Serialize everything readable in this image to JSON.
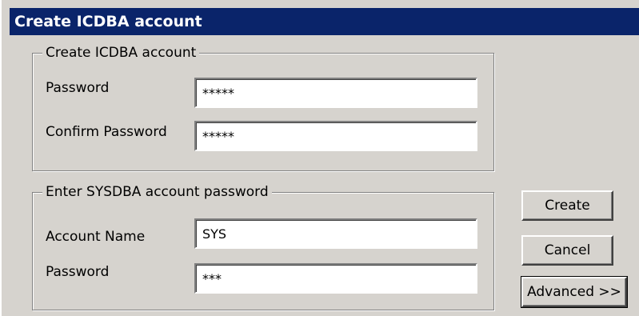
{
  "window": {
    "title": "Create ICDBA account"
  },
  "icdba_group": {
    "label": "Create ICDBA account",
    "password_label": "Password",
    "password_value": "*****",
    "confirm_label": "Confirm Password",
    "confirm_value": "*****"
  },
  "sysdba_group": {
    "label": "Enter SYSDBA account password",
    "account_label": "Account Name",
    "account_value": "SYS",
    "password_label": "Password",
    "password_value": "***"
  },
  "buttons": {
    "create": "Create",
    "cancel": "Cancel",
    "advanced": "Advanced >>"
  },
  "colors": {
    "titlebar": "#0a246a",
    "background": "#d6d3ce"
  }
}
